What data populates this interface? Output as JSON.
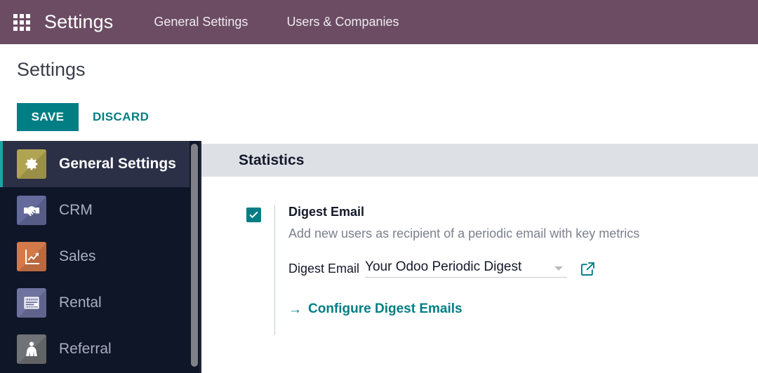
{
  "navbar": {
    "apps_icon": "apps-grid-icon",
    "brand": "Settings",
    "menus": [
      {
        "label": "General Settings"
      },
      {
        "label": "Users & Companies"
      }
    ],
    "background_color": "#6b4c63"
  },
  "control_panel": {
    "title": "Settings",
    "save_label": "SAVE",
    "discard_label": "DISCARD",
    "accent_color": "#017e84"
  },
  "sidebar": {
    "items": [
      {
        "label": "General Settings",
        "icon": "gear-icon",
        "icon_color": "#b0a454",
        "active": true
      },
      {
        "label": "CRM",
        "icon": "handshake-icon",
        "icon_color": "#646a9b",
        "active": false
      },
      {
        "label": "Sales",
        "icon": "sales-chart-icon",
        "icon_color": "#d4794a",
        "active": false
      },
      {
        "label": "Rental",
        "icon": "rental-calendar-icon",
        "icon_color": "#6f739f",
        "active": false
      },
      {
        "label": "Referral",
        "icon": "referral-cape-icon",
        "icon_color": "#6f7276",
        "active": false
      }
    ],
    "active_background": "#2b3047",
    "background": "#0e1628",
    "active_marker_color": "#1aa5a0",
    "scrollbar": "sidebar-scrollbar"
  },
  "settings": {
    "section_title": "Statistics",
    "digest": {
      "checkbox_checked": true,
      "title": "Digest Email",
      "description": "Add new users as recipient of a periodic email with key metrics",
      "field_label": "Digest Email",
      "field_value": "Your Odoo Periodic Digest",
      "dropdown_icon": "chevron-down-icon",
      "external_link_icon": "external-link-icon",
      "configure_link": "Configure Digest Emails",
      "configure_arrow": "→"
    }
  }
}
